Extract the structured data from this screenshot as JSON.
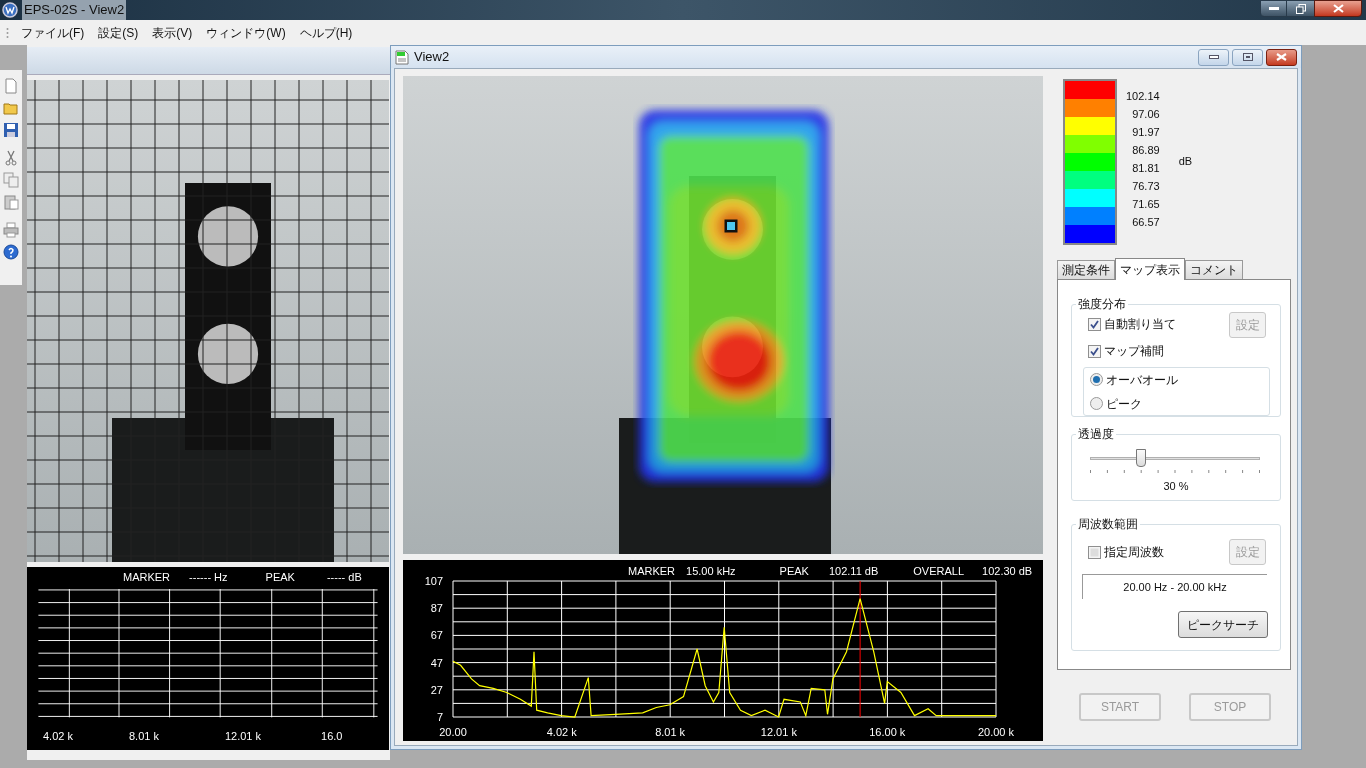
{
  "app_window": {
    "title": "EPS-02S - View2"
  },
  "menu": [
    "ファイル(F)",
    "設定(S)",
    "表示(V)",
    "ウィンドウ(W)",
    "ヘルプ(H)"
  ],
  "view1": {
    "spectrum": {
      "marker_label": "MARKER",
      "marker_value": "------ Hz",
      "peak_label": "PEAK",
      "peak_value": "----- dB",
      "x_labels": [
        "4.02 k",
        "8.01 k",
        "12.01 k",
        "16.0"
      ]
    }
  },
  "view2": {
    "title": "View2",
    "spectrum": {
      "marker_label": "MARKER",
      "marker_value": "15.00 kHz",
      "peak_label": "PEAK",
      "peak_value": "102.11 dB",
      "overall_label": "OVERALL",
      "overall_value": "102.30 dB",
      "chart_data": {
        "type": "line",
        "x": [
          20,
          300,
          700,
          1000,
          1500,
          2000,
          2500,
          2900,
          3000,
          3100,
          3500,
          4000,
          4500,
          5000,
          5100,
          6000,
          7000,
          7500,
          8000,
          8500,
          9000,
          9300,
          9600,
          9800,
          10000,
          10200,
          10600,
          11000,
          11500,
          12000,
          12200,
          12800,
          13000,
          13200,
          13700,
          13800,
          14000,
          14500,
          15000,
          15500,
          15900,
          16000,
          16500,
          17000,
          17500,
          17800,
          18000,
          19000,
          20000
        ],
        "series": [
          {
            "color": "#ffff00",
            "values": [
              48,
              45,
              35,
              30,
              28,
              25,
              20,
              15,
              55,
              12,
              10,
              8,
              7,
              36,
              8,
              9,
              10,
              14,
              16,
              22,
              57,
              30,
              18,
              25,
              73,
              25,
              12,
              8,
              12,
              7,
              20,
              18,
              8,
              28,
              27,
              9,
              35,
              55,
              94,
              55,
              17,
              33,
              25,
              8,
              13,
              8,
              8,
              8,
              8
            ]
          }
        ],
        "xlim": [
          20,
          20000
        ],
        "ylim": [
          7,
          107
        ],
        "xticks": [
          {
            "value": 20,
            "label": "20.00"
          },
          {
            "value": 4020,
            "label": "4.02 k"
          },
          {
            "value": 8010,
            "label": "8.01 k"
          },
          {
            "value": 12010,
            "label": "12.01 k"
          },
          {
            "value": 16000,
            "label": "16.00 k"
          },
          {
            "value": 20000,
            "label": "20.00 k"
          }
        ],
        "yticks": [
          7,
          27,
          47,
          67,
          87,
          107
        ],
        "grid": true,
        "ref_lines": [
          {
            "axis": "x",
            "value": 15000,
            "color": "#ff0000"
          }
        ]
      }
    },
    "legend": {
      "bands": [
        {
          "color": "#ff0000"
        },
        {
          "color": "#ff8000"
        },
        {
          "color": "#ffff00"
        },
        {
          "color": "#80ff00"
        },
        {
          "color": "#00ff00"
        },
        {
          "color": "#00ff80"
        },
        {
          "color": "#00ffff"
        },
        {
          "color": "#0080ff"
        },
        {
          "color": "#0000ff"
        }
      ],
      "labels": [
        "102.14",
        "97.06",
        "91.97",
        "86.89",
        "81.81",
        "76.73",
        "71.65",
        "66.57"
      ],
      "unit": "dB"
    },
    "tabs": [
      {
        "label": "測定条件",
        "selected": false
      },
      {
        "label": "マップ表示",
        "selected": true
      },
      {
        "label": "コメント",
        "selected": false
      }
    ],
    "intensity": {
      "title": "強度分布",
      "checkboxes": [
        {
          "label": "自動割り当て",
          "checked": true
        },
        {
          "label": "マップ補間",
          "checked": true
        }
      ],
      "button": {
        "label": "設定",
        "disabled": true
      },
      "radios": [
        {
          "label": "オーバオール",
          "selected": true
        },
        {
          "label": "ピーク",
          "selected": false
        }
      ]
    },
    "transparency": {
      "title": "透過度",
      "level": 0.3,
      "reading": "30 %"
    },
    "frequency": {
      "title": "周波数範囲",
      "checkbox": {
        "label": "指定周波数",
        "checked": false
      },
      "button": {
        "label": "設定",
        "disabled": true
      },
      "range": "20.00 Hz - 20.00 kHz",
      "search_button": {
        "label": "ピークサーチ",
        "disabled": false
      }
    },
    "buttons": [
      {
        "label": "START",
        "disabled": true
      },
      {
        "label": "STOP",
        "disabled": true
      }
    ]
  }
}
